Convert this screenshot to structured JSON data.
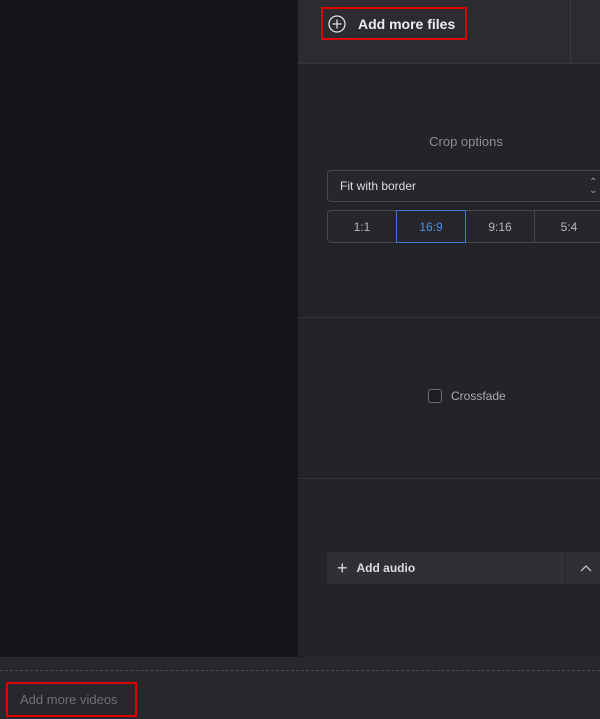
{
  "toolbar": {
    "add_files_label": "Add more files"
  },
  "crop": {
    "title": "Crop options",
    "fit_select_value": "Fit with border",
    "ratios": [
      "1:1",
      "16:9",
      "9:16",
      "5:4"
    ],
    "active_ratio": "16:9"
  },
  "crossfade": {
    "label": "Crossfade",
    "checked": false
  },
  "audio": {
    "add_label": "Add audio"
  },
  "footer": {
    "add_videos_label": "Add more videos"
  },
  "colors": {
    "accent": "#3a7bd5",
    "highlight": "#e00000"
  }
}
